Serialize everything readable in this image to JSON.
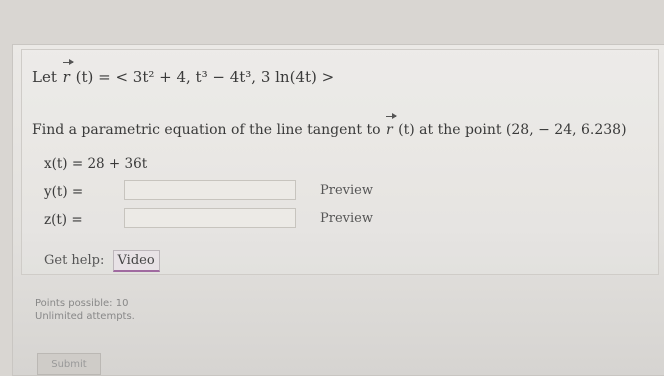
{
  "problem": {
    "let_label": "Let",
    "r_symbol": "r",
    "func_def": "(t) = < 3t² + 4, t³ − 4t³, 3 ln(4t) >",
    "find_text_before": "Find a parametric equation of the line tangent to",
    "find_text_after": "(t) at the point (28,  − 24, 6.238)"
  },
  "answers": {
    "x_label": "x(t) = 28 + 36t",
    "y_label": "y(t) =",
    "z_label": "z(t) =",
    "y_value": "",
    "z_value": "",
    "preview_label": "Preview"
  },
  "help": {
    "label": "Get help:",
    "video_label": "Video"
  },
  "meta": {
    "points": "Points possible: 10",
    "attempts": "Unlimited attempts."
  },
  "submit_label": "Submit"
}
